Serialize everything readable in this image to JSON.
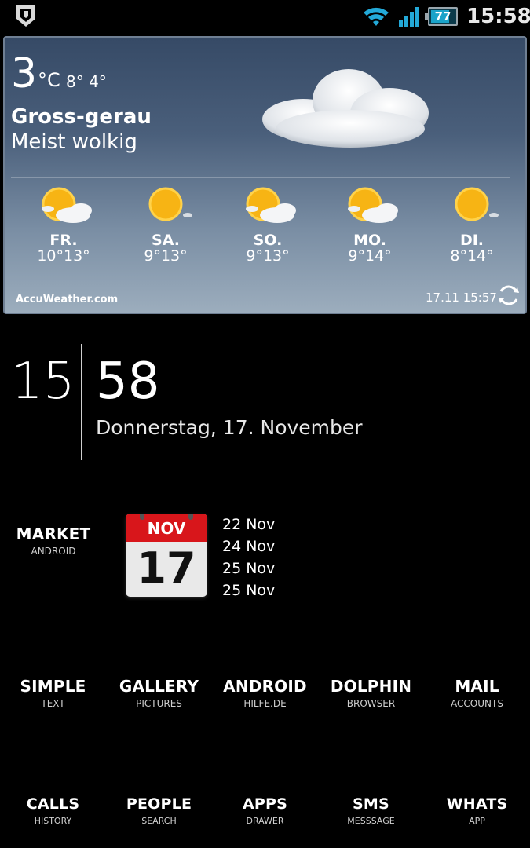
{
  "status_bar": {
    "notification_icon": "shield-icon",
    "wifi_icon": "wifi-icon",
    "signal_icon": "signal-bars-icon",
    "battery_level": "77",
    "battery_percent": 77,
    "time": "15:58"
  },
  "weather": {
    "temperature": "3",
    "unit": "°C",
    "high_low": "8° 4°",
    "city": "Gross-gerau",
    "condition": "Meist wolkig",
    "forecast": [
      {
        "day": "FR.",
        "temps": "10°13°",
        "icon": "sun-cloud-icon"
      },
      {
        "day": "SA.",
        "temps": "9°13°",
        "icon": "sun-icon"
      },
      {
        "day": "SO.",
        "temps": "9°13°",
        "icon": "sun-cloud-icon"
      },
      {
        "day": "MO.",
        "temps": "9°14°",
        "icon": "sun-cloud-icon"
      },
      {
        "day": "DI.",
        "temps": "8°14°",
        "icon": "sun-icon"
      }
    ],
    "brand": "AccuWeather.com",
    "updated": "17.11 15:57",
    "refresh_icon": "refresh-icon"
  },
  "clock": {
    "hours": "15",
    "minutes": "58",
    "date": "Donnerstag, 17. November"
  },
  "market": {
    "title": "MARKET",
    "subtitle": "ANDROID"
  },
  "calendar": {
    "month": "NOV",
    "day": "17",
    "events": [
      "22 Nov",
      "24 Nov",
      "25 Nov",
      "25 Nov"
    ]
  },
  "apps_row1": [
    {
      "title": "SIMPLE",
      "subtitle": "TEXT"
    },
    {
      "title": "GALLERY",
      "subtitle": "PICTURES"
    },
    {
      "title": "ANDROID",
      "subtitle": "HILFE.DE"
    },
    {
      "title": "DOLPHIN",
      "subtitle": "BROWSER"
    },
    {
      "title": "MAIL",
      "subtitle": "ACCOUNTS"
    }
  ],
  "apps_row2": [
    {
      "title": "CALLS",
      "subtitle": "HISTORY"
    },
    {
      "title": "PEOPLE",
      "subtitle": "SEARCH"
    },
    {
      "title": "APPS",
      "subtitle": "DRAWER"
    },
    {
      "title": "SMS",
      "subtitle": "MESSSAGE"
    },
    {
      "title": "WHATS",
      "subtitle": "APP"
    }
  ]
}
